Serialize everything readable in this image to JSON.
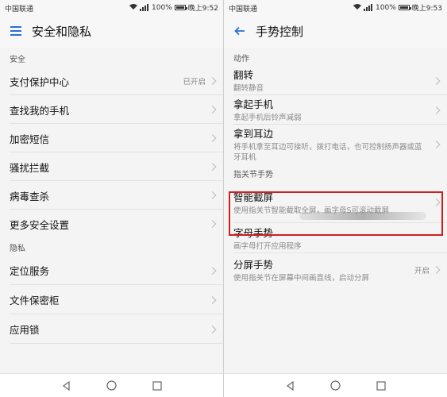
{
  "left": {
    "status": {
      "carrier": "中国联通",
      "battery": "100%",
      "time": "晚上9:52"
    },
    "title": "安全和隐私",
    "sections": [
      {
        "header": "安全",
        "items": [
          {
            "label": "支付保护中心",
            "value": "已开启"
          },
          {
            "label": "查找我的手机"
          },
          {
            "label": "加密短信"
          },
          {
            "label": "骚扰拦截"
          },
          {
            "label": "病毒查杀"
          },
          {
            "label": "更多安全设置"
          }
        ]
      },
      {
        "header": "隐私",
        "items": [
          {
            "label": "定位服务"
          },
          {
            "label": "文件保密柜"
          },
          {
            "label": "应用锁"
          }
        ]
      }
    ]
  },
  "right": {
    "status": {
      "carrier": "中国联通",
      "battery": "100%",
      "time": "晚上9:53"
    },
    "title": "手势控制",
    "sections": [
      {
        "header": "动作",
        "items": [
          {
            "label": "翻转",
            "sub": "翻转静音"
          },
          {
            "label": "拿起手机",
            "sub": "拿起手机后铃声减弱"
          },
          {
            "label": "拿到耳边",
            "sub": "将手机拿至耳边可接听，拨打电话，也可控制扬声器或蓝牙耳机"
          }
        ]
      },
      {
        "header": "指关节手势",
        "items": [
          {
            "label": "智能截屏",
            "sub": "使用指关节智能截取全屏，画字母S可滚动截屏"
          },
          {
            "label": "字母手势",
            "sub": "画字母打开应用程序"
          },
          {
            "label": "分屏手势",
            "sub": "使用指关节在屏幕中间画直线，启动分屏",
            "value": "开启"
          }
        ]
      }
    ]
  },
  "colors": {
    "highlight": "#d11f1f",
    "accent_icon": "#2a6fd6"
  },
  "icons": {
    "menu": "menu-icon",
    "back": "back-arrow-icon",
    "chevron": "chevron-right-icon"
  }
}
